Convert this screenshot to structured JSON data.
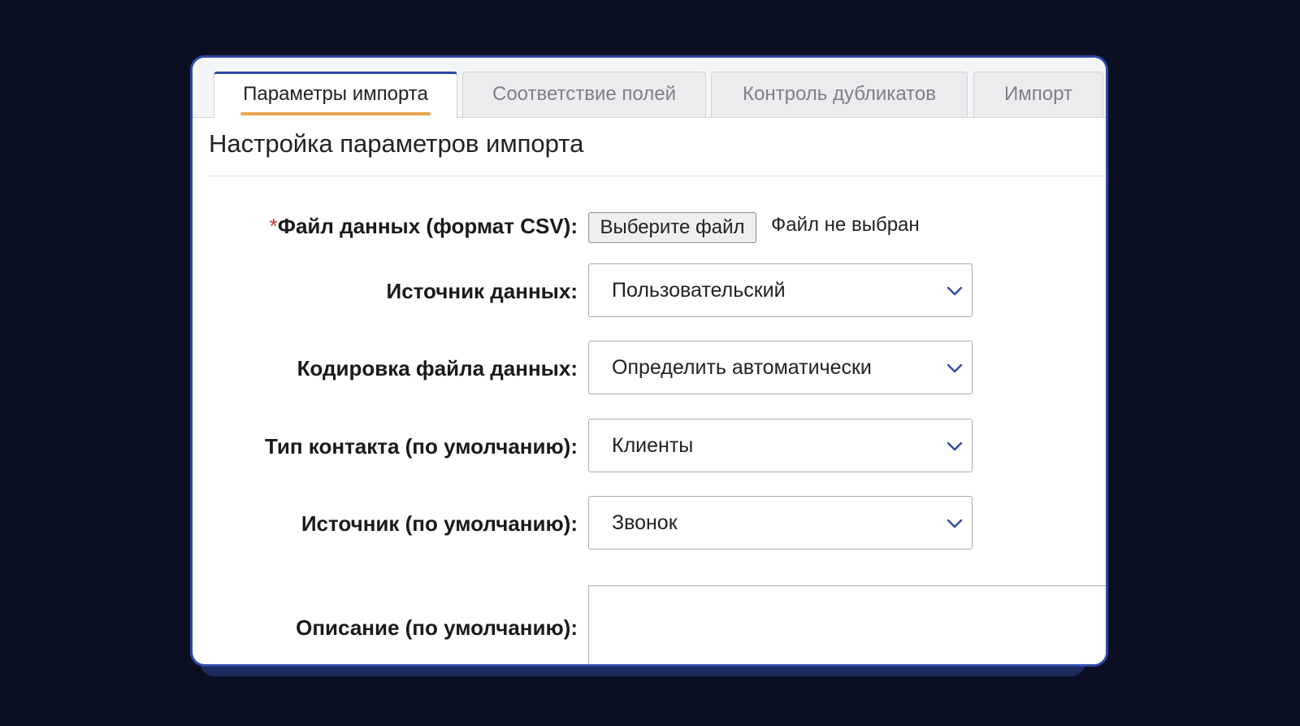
{
  "tabs": [
    {
      "label": "Параметры импорта",
      "active": true
    },
    {
      "label": "Соответствие полей",
      "active": false
    },
    {
      "label": "Контроль дубликатов",
      "active": false
    },
    {
      "label": "Импорт",
      "active": false
    }
  ],
  "page_title": "Настройка параметров импорта",
  "form": {
    "file": {
      "required_mark": "*",
      "label": "Файл данных (формат CSV):",
      "button_label": "Выберите файл",
      "status": "Файл не выбран"
    },
    "data_source": {
      "label": "Источник данных:",
      "value": "Пользовательский"
    },
    "encoding": {
      "label": "Кодировка файла данных:",
      "value": "Определить автоматически"
    },
    "contact_type": {
      "label": "Тип контакта (по умолчанию):",
      "value": "Клиенты"
    },
    "source": {
      "label": "Источник (по умолчанию):",
      "value": "Звонок"
    },
    "description": {
      "label": "Описание (по умолчанию):",
      "value": ""
    }
  },
  "colors": {
    "accent": "#2e4aa8",
    "active_tab_underline": "#e8a452",
    "required": "#c0392b",
    "background": "#0a0f22"
  },
  "icons": {
    "select_arrow": "chevron-down-icon"
  }
}
